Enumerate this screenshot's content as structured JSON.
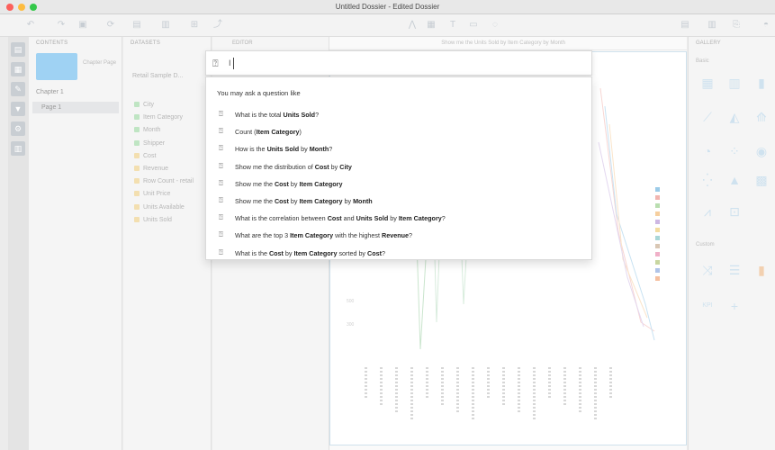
{
  "window": {
    "title": "Untitled Dossier - Edited Dossier"
  },
  "panels": {
    "contents": {
      "header": "CONTENTS",
      "thumb_label": "Chapter Page",
      "chapter": "Chapter 1",
      "page": "Page 1"
    },
    "datasets": {
      "header": "DATASETS",
      "source": "Retail Sample D...",
      "items": [
        {
          "label": "City",
          "kind": "attr"
        },
        {
          "label": "Item Category",
          "kind": "attr"
        },
        {
          "label": "Month",
          "kind": "attr"
        },
        {
          "label": "Shipper",
          "kind": "attr"
        },
        {
          "label": "Cost",
          "kind": "metric"
        },
        {
          "label": "Revenue",
          "kind": "metric"
        },
        {
          "label": "Row Count - retail",
          "kind": "metric"
        },
        {
          "label": "Unit Price",
          "kind": "metric"
        },
        {
          "label": "Units Available",
          "kind": "metric"
        },
        {
          "label": "Units Sold",
          "kind": "metric"
        }
      ]
    },
    "editor": {
      "tab": "EDITOR"
    },
    "canvas": {
      "title": "Show me the Units Sold by Item Category by Month"
    },
    "gallery": {
      "header": "GALLERY",
      "section_basic": "Basic",
      "section_custom": "Custom"
    }
  },
  "nlq": {
    "value": "I",
    "header": "You may ask a question like",
    "suggestions": [
      [
        "What is the total ",
        {
          "b": "Units Sold"
        },
        "?"
      ],
      [
        "Count (",
        {
          "b": "Item Category"
        },
        ")"
      ],
      [
        "How is the ",
        {
          "b": "Units Sold"
        },
        " by ",
        {
          "b": "Month"
        },
        "?"
      ],
      [
        "Show me the distribution of ",
        {
          "b": "Cost"
        },
        " by ",
        {
          "b": "City"
        }
      ],
      [
        "Show me the ",
        {
          "b": "Cost"
        },
        " by ",
        {
          "b": "Item Category"
        }
      ],
      [
        "Show me the ",
        {
          "b": "Cost"
        },
        " by ",
        {
          "b": "Item Category"
        },
        " by ",
        {
          "b": "Month"
        }
      ],
      [
        "What is the correlation between ",
        {
          "b": "Cost"
        },
        " and ",
        {
          "b": "Units Sold"
        },
        " by ",
        {
          "b": "Item Category"
        },
        "?"
      ],
      [
        "What are the top 3 ",
        {
          "b": "Item Category"
        },
        " with the highest ",
        {
          "b": "Revenue"
        },
        "?"
      ],
      [
        "What is the ",
        {
          "b": "Cost"
        },
        " by ",
        {
          "b": "Item Category"
        },
        " sorted by ",
        {
          "b": "Cost"
        },
        "?"
      ]
    ]
  },
  "colors": {
    "legend": [
      "#9ccbe8",
      "#f2b5b0",
      "#b9deb0",
      "#f6cf9f",
      "#cdb7e3",
      "#f3dca0",
      "#a9d7d8",
      "#d9c7b4",
      "#f0b0c8",
      "#c8d6a0",
      "#b0c4e8",
      "#f5c0a0"
    ]
  }
}
